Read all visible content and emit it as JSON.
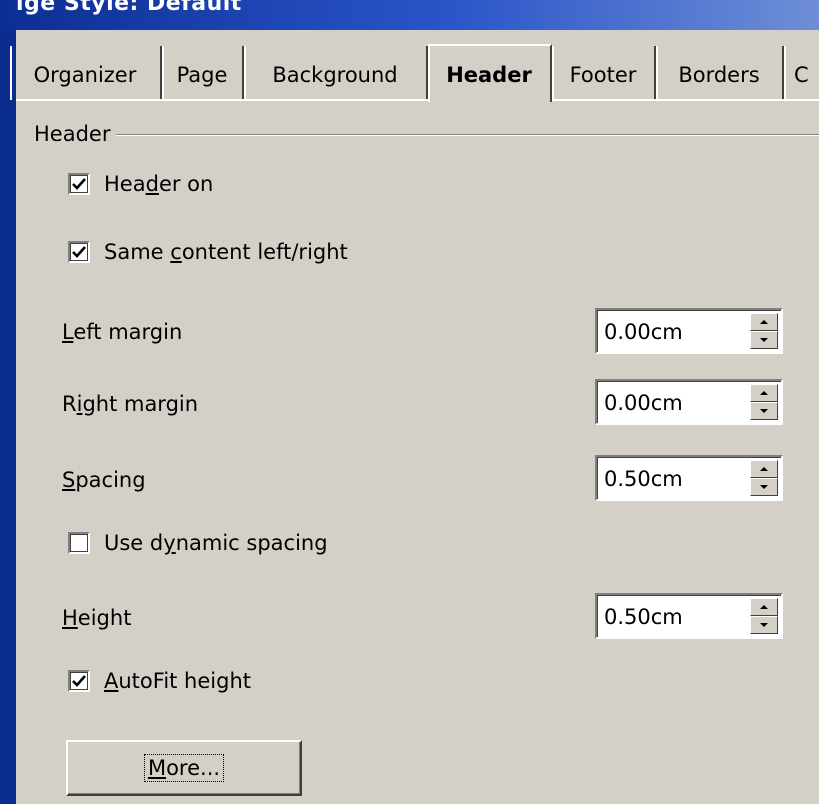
{
  "window": {
    "title": "ige Style: Default"
  },
  "tabs": [
    {
      "label": "Organizer",
      "active": false
    },
    {
      "label": "Page",
      "active": false
    },
    {
      "label": "Background",
      "active": false
    },
    {
      "label": "Header",
      "active": true
    },
    {
      "label": "Footer",
      "active": false
    },
    {
      "label": "Borders",
      "active": false
    },
    {
      "label": "C",
      "active": false
    }
  ],
  "group": {
    "label": "Header"
  },
  "checkboxes": {
    "header_on": {
      "pre": "Hea",
      "mnemonic": "d",
      "post": "er on",
      "checked": true
    },
    "same_content": {
      "pre": "Same ",
      "mnemonic": "c",
      "post": "ontent left/right",
      "checked": true
    },
    "dynamic_spacing": {
      "pre": "Use d",
      "mnemonic": "y",
      "post": "namic spacing",
      "checked": false
    },
    "autofit_height": {
      "pre": "",
      "mnemonic": "A",
      "post": "utoFit height",
      "checked": true
    }
  },
  "fields": {
    "left_margin": {
      "pre": "",
      "mnemonic": "L",
      "post": "eft margin",
      "value": "0.00cm"
    },
    "right_margin": {
      "pre": "R",
      "mnemonic": "i",
      "post": "ght margin",
      "value": "0.00cm"
    },
    "spacing": {
      "pre": "",
      "mnemonic": "S",
      "post": "pacing",
      "value": "0.50cm"
    },
    "height": {
      "pre": "",
      "mnemonic": "H",
      "post": "eight",
      "value": "0.50cm"
    }
  },
  "more_button": {
    "pre": "",
    "mnemonic": "M",
    "post": "ore..."
  }
}
